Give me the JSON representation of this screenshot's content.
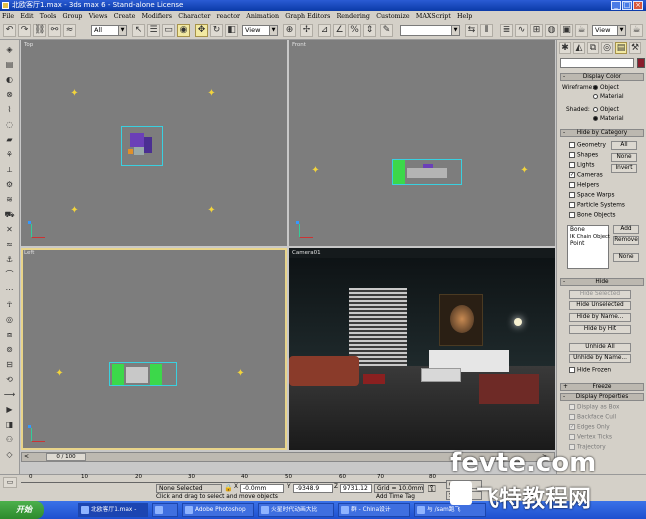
{
  "window": {
    "title": "北欧客厅1.max - 3ds max 6 - Stand-alone License",
    "min": "_",
    "max": "□",
    "close": "×"
  },
  "menu": [
    "File",
    "Edit",
    "Tools",
    "Group",
    "Views",
    "Create",
    "Modifiers",
    "Character",
    "reactor",
    "Animation",
    "Graph Editors",
    "Rendering",
    "Customize",
    "MAXScript",
    "Help"
  ],
  "toolbar": {
    "selection_filter": "All",
    "ref_coord": "View",
    "view_right": "View"
  },
  "viewports": {
    "top": "Top",
    "front": "Front",
    "left": "Left",
    "camera": "Camera01"
  },
  "panel": {
    "display_color": {
      "title": "Display Color",
      "wireframe_label": "Wireframe:",
      "shaded_label": "Shaded:",
      "object": "Object",
      "material": "Material",
      "wireframe_selected": "Object",
      "shaded_selected": "Material"
    },
    "hide_by_category": {
      "title": "Hide by Category",
      "items": [
        {
          "label": "Geometry",
          "checked": false
        },
        {
          "label": "Shapes",
          "checked": false
        },
        {
          "label": "Lights",
          "checked": false
        },
        {
          "label": "Cameras",
          "checked": true
        },
        {
          "label": "Helpers",
          "checked": false
        },
        {
          "label": "Space Warps",
          "checked": false
        },
        {
          "label": "Particle Systems",
          "checked": false
        },
        {
          "label": "Bone Objects",
          "checked": false
        }
      ],
      "all": "All",
      "none": "None",
      "invert": "Invert",
      "list": [
        "Bone",
        "IK Chain Object",
        "Point"
      ],
      "add": "Add",
      "remove": "Remove",
      "none2": "None"
    },
    "hide": {
      "title": "Hide",
      "buttons": [
        "Hide Selected",
        "Hide Unselected",
        "Hide by Name...",
        "Hide by Hit",
        "Unhide All",
        "Unhide by Name...",
        "Hide Frozen"
      ]
    },
    "freeze": {
      "title": "Freeze"
    },
    "display_properties": {
      "title": "Display Properties",
      "items": [
        "Display as Box",
        "Backface Cull",
        "Edges Only",
        "Vertex Ticks",
        "Trajectory"
      ]
    }
  },
  "timeline": {
    "frame": "0 / 100",
    "ticks": [
      "0",
      "10",
      "20",
      "30",
      "40",
      "50",
      "60",
      "70",
      "80"
    ]
  },
  "status": {
    "selection": "None Selected",
    "prompt": "Click and drag to select and move objects",
    "x_label": "X",
    "x_value": "-0.0mm",
    "y_label": "Y",
    "y_value": "-9348.9",
    "z_label": "Z",
    "z_value": "9731.12",
    "grid": "Grid = 10.0mm",
    "add_time_tag": "Add Time Tag",
    "auto_key": "uto Key",
    "set_key": "Set Key"
  },
  "taskbar": {
    "start": "开始",
    "tasks": [
      "北欧客厅1.max -",
      "",
      "Adobe Photoshop",
      "火星时代动画大比",
      "群 - China设计",
      "与 /sam跑飞"
    ]
  },
  "watermark": {
    "line1": "fevte.com",
    "line2": "飞特教程网"
  }
}
